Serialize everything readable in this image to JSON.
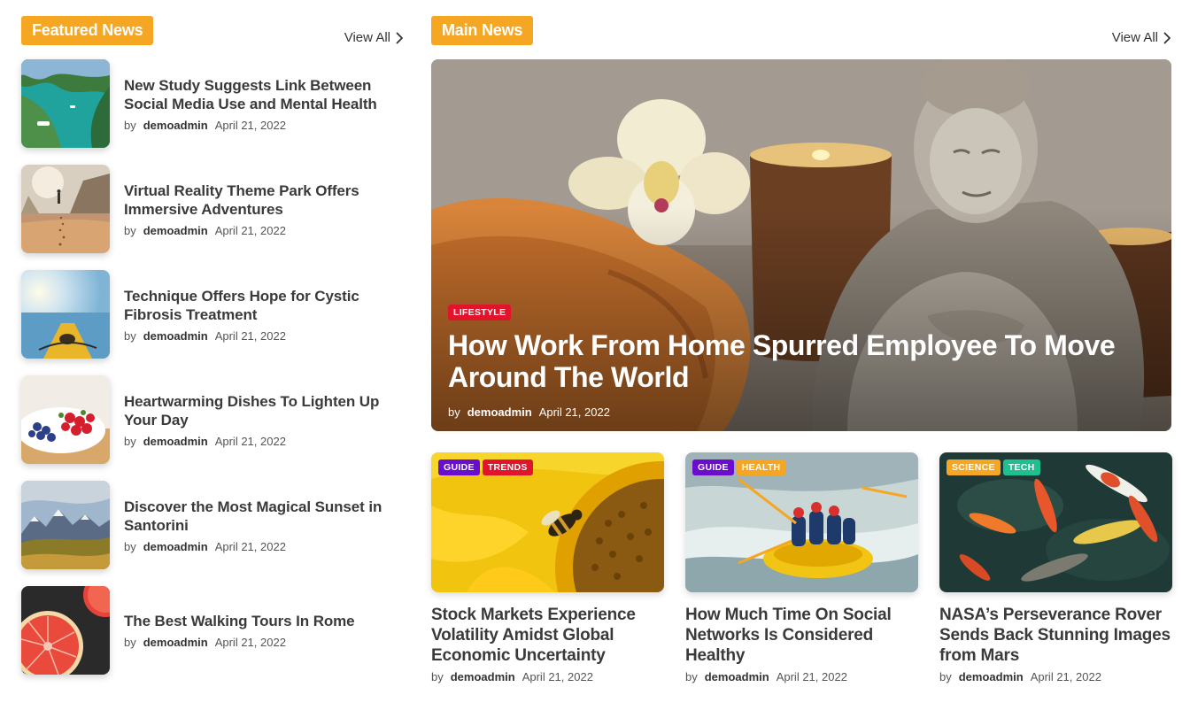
{
  "featured": {
    "heading": "Featured News",
    "view_all": "View All",
    "items": [
      {
        "title": "New Study Suggests Link Between Social Media Use and Mental Health",
        "by": "by",
        "author": "demoadmin",
        "date": "April 21, 2022",
        "thumb": "coastline-boats"
      },
      {
        "title": "Virtual Reality Theme Park Offers Immersive Adventures",
        "by": "by",
        "author": "demoadmin",
        "date": "April 21, 2022",
        "thumb": "beach-walker"
      },
      {
        "title": "Technique Offers Hope for Cystic Fibrosis Treatment",
        "by": "by",
        "author": "demoadmin",
        "date": "April 21, 2022",
        "thumb": "kayak-sea"
      },
      {
        "title": "Heartwarming Dishes To Lighten Up Your Day",
        "by": "by",
        "author": "demoadmin",
        "date": "April 21, 2022",
        "thumb": "berries-bowl"
      },
      {
        "title": "Discover the Most Magical Sunset in Santorini",
        "by": "by",
        "author": "demoadmin",
        "date": "April 21, 2022",
        "thumb": "mountain-valley"
      },
      {
        "title": "The Best Walking Tours In Rome",
        "by": "by",
        "author": "demoadmin",
        "date": "April 21, 2022",
        "thumb": "grapefruit"
      }
    ]
  },
  "main": {
    "heading": "Main News",
    "view_all": "View All",
    "hero": {
      "tag": "LIFESTYLE",
      "tag_color": "#e0142b",
      "title": "How Work From Home Spurred Employee To Move Around The World",
      "by": "by",
      "author": "demoadmin",
      "date": "April 21, 2022"
    },
    "cards": [
      {
        "tags": [
          {
            "label": "GUIDE",
            "color": "#6a0dcc"
          },
          {
            "label": "TRENDS",
            "color": "#e0142b"
          }
        ],
        "title": "Stock Markets Experience Volatility Amidst Global Economic Uncertainty",
        "by": "by",
        "author": "demoadmin",
        "date": "April 21, 2022",
        "image": "sunflower-bee"
      },
      {
        "tags": [
          {
            "label": "GUIDE",
            "color": "#6a0dcc"
          },
          {
            "label": "HEALTH",
            "color": "#f5a623"
          }
        ],
        "title": "How Much Time On Social Networks Is Considered Healthy",
        "by": "by",
        "author": "demoadmin",
        "date": "April 21, 2022",
        "image": "river-rafting"
      },
      {
        "tags": [
          {
            "label": "SCIENCE",
            "color": "#f5a623"
          },
          {
            "label": "TECH",
            "color": "#1fbf8f"
          }
        ],
        "title": "NASA’s Perseverance Rover Sends Back Stunning Images from Mars",
        "by": "by",
        "author": "demoadmin",
        "date": "April 21, 2022",
        "image": "koi-fish"
      }
    ]
  },
  "colors": {
    "accent": "#f5a623",
    "lifestyle": "#e0142b"
  }
}
